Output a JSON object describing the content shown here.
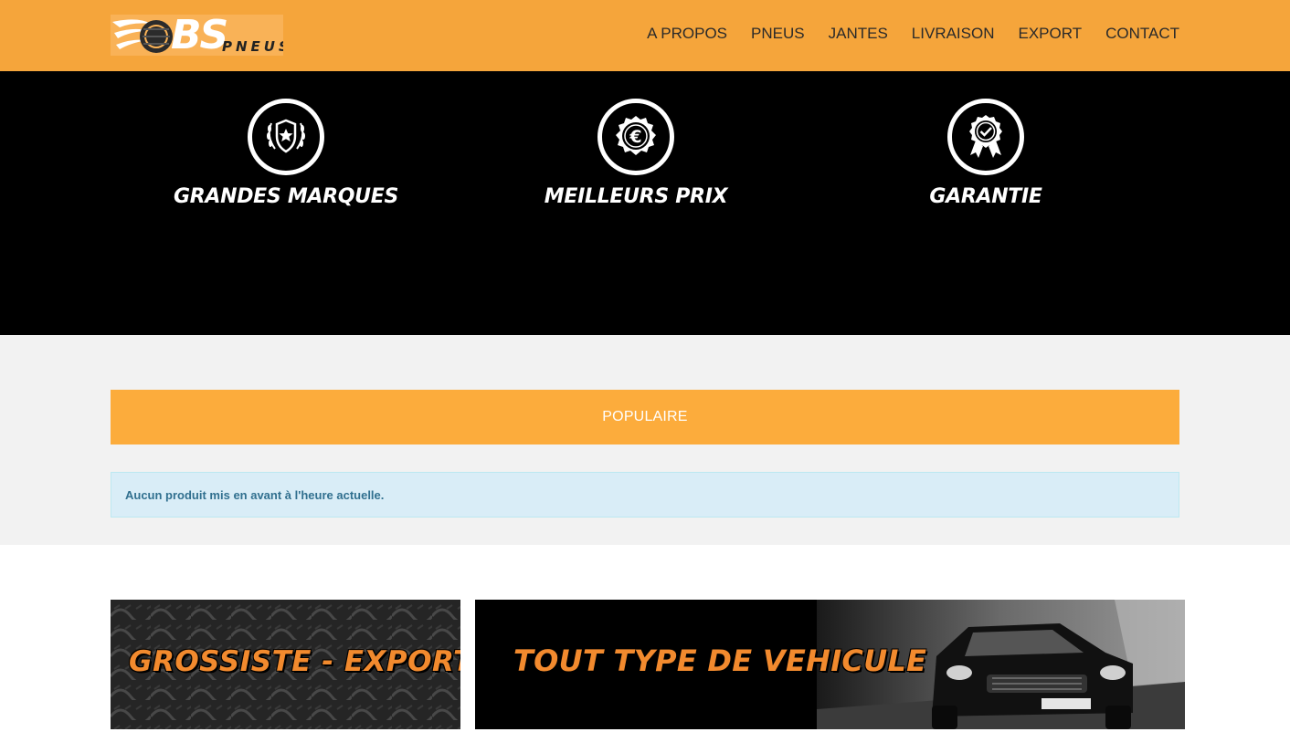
{
  "header": {
    "logo": {
      "main": "BS",
      "sub": "PNEUS"
    },
    "nav": [
      {
        "label": "A PROPOS"
      },
      {
        "label": "PNEUS"
      },
      {
        "label": "JANTES"
      },
      {
        "label": "LIVRAISON"
      },
      {
        "label": "EXPORT"
      },
      {
        "label": "CONTACT"
      }
    ]
  },
  "features": [
    {
      "title": "GRANDES MARQUES",
      "icon": "laurel-shield-star-icon"
    },
    {
      "title": "MEILLEURS PRIX",
      "icon": "euro-seal-icon"
    },
    {
      "title": "GARANTIE",
      "icon": "award-ribbon-check-icon"
    }
  ],
  "popular": {
    "heading": "POPULAIRE",
    "message": "Aucun produit mis en avant à l'heure actuelle."
  },
  "banners": {
    "left": "GROSSISTE - EXPORT",
    "right": "TOUT TYPE DE VEHICULE"
  },
  "colors": {
    "header_bg": "#f5a53b",
    "accent": "#fcac3c",
    "alert_bg": "#d9edf7",
    "alert_text": "#31708f",
    "banner_text": "#f28a2e"
  }
}
